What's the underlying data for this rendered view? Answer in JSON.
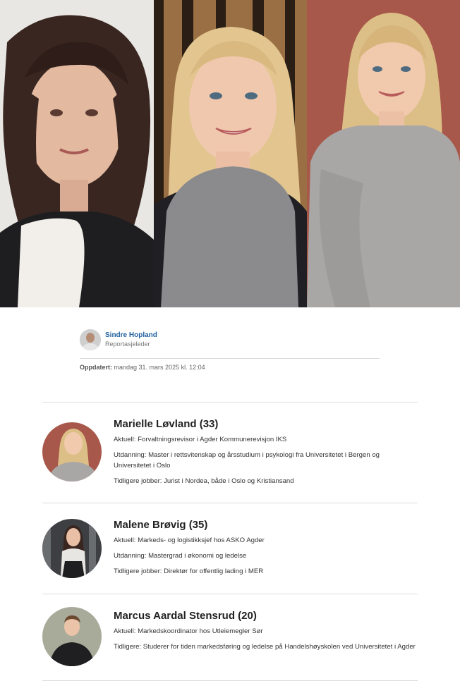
{
  "byline": {
    "author_name": "Sindre Hopland",
    "author_role": "Reportasjeleder",
    "updated_label": "Oppdatert:",
    "updated_value": "mandag 31. mars 2025 kl. 12:04"
  },
  "people": [
    {
      "heading": "Marielle Løvland (33)",
      "lines": [
        "Aktuell: Forvaltningsrevisor i Agder Kommunerevisjon IKS",
        "Utdanning: Master i rettsvitenskap og årsstudium i psykologi fra Universitetet i Bergen og Universitetet i Oslo",
        "Tidligere jobber: Jurist i Nordea, både i Oslo og Kristiansand"
      ]
    },
    {
      "heading": "Malene Brøvig (35)",
      "lines": [
        "Aktuell: Markeds- og logistikksjef hos ASKO Agder",
        "Utdanning: Mastergrad i økonomi og ledelse",
        "Tidligere jobber: Direktør for offentlig lading i MER"
      ]
    },
    {
      "heading": "Marcus Aardal Stensrud (20)",
      "lines": [
        "Aktuell: Markedskoordinator hos Utleiemegler Sør",
        "Tidligere: Studerer for tiden markedsføring og ledelse på Handelshøyskolen ved Universitetet i Agder"
      ]
    }
  ]
}
